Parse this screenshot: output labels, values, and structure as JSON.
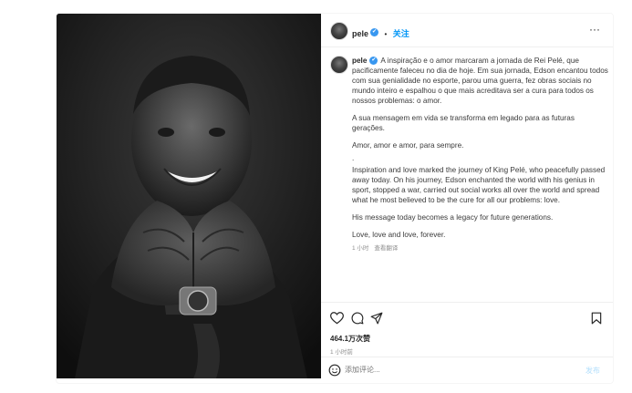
{
  "post": {
    "username": "pele",
    "verified_mark": "✔",
    "separator": "•",
    "follow_label": "关注",
    "more_label": "···",
    "caption_username": "pele",
    "caption_paragraphs": [
      "A inspiração e o amor marcaram a jornada de Rei Pelé, que pacificamente faleceu no dia de hoje. Em sua jornada, Edson encantou todos com sua genialidade no esporte, parou uma guerra, fez obras sociais no mundo inteiro e espalhou o que mais acreditava ser a cura para todos os nossos problemas: o amor.",
      "A sua mensagem em vida se transforma em legado para as futuras gerações.",
      "Amor, amor e amor, para sempre.",
      ".",
      "Inspiration and love marked the journey of King Pelé, who peacefully passed away today. On his journey, Edson enchanted the world with his genius in sport, stopped a war, carried out social works all over the world and spread what he most believed to be the cure for all our problems: love.",
      "His message today becomes a legacy for future generations.",
      "Love, love and love, forever."
    ],
    "caption_time": "1 小时",
    "see_translation": "查看翻译",
    "likes": "464.1万次赞",
    "time_ago": "1 小时前",
    "comment_placeholder": "添加评论...",
    "post_button": "发布"
  },
  "icons": {
    "like": "heart-icon",
    "comment": "comment-icon",
    "share": "share-icon",
    "save": "bookmark-icon",
    "emoji": "emoji-icon",
    "more": "more-icon"
  },
  "colors": {
    "accent": "#0095f6",
    "verified": "#3897f0",
    "post_disabled": "#b2dffc"
  }
}
